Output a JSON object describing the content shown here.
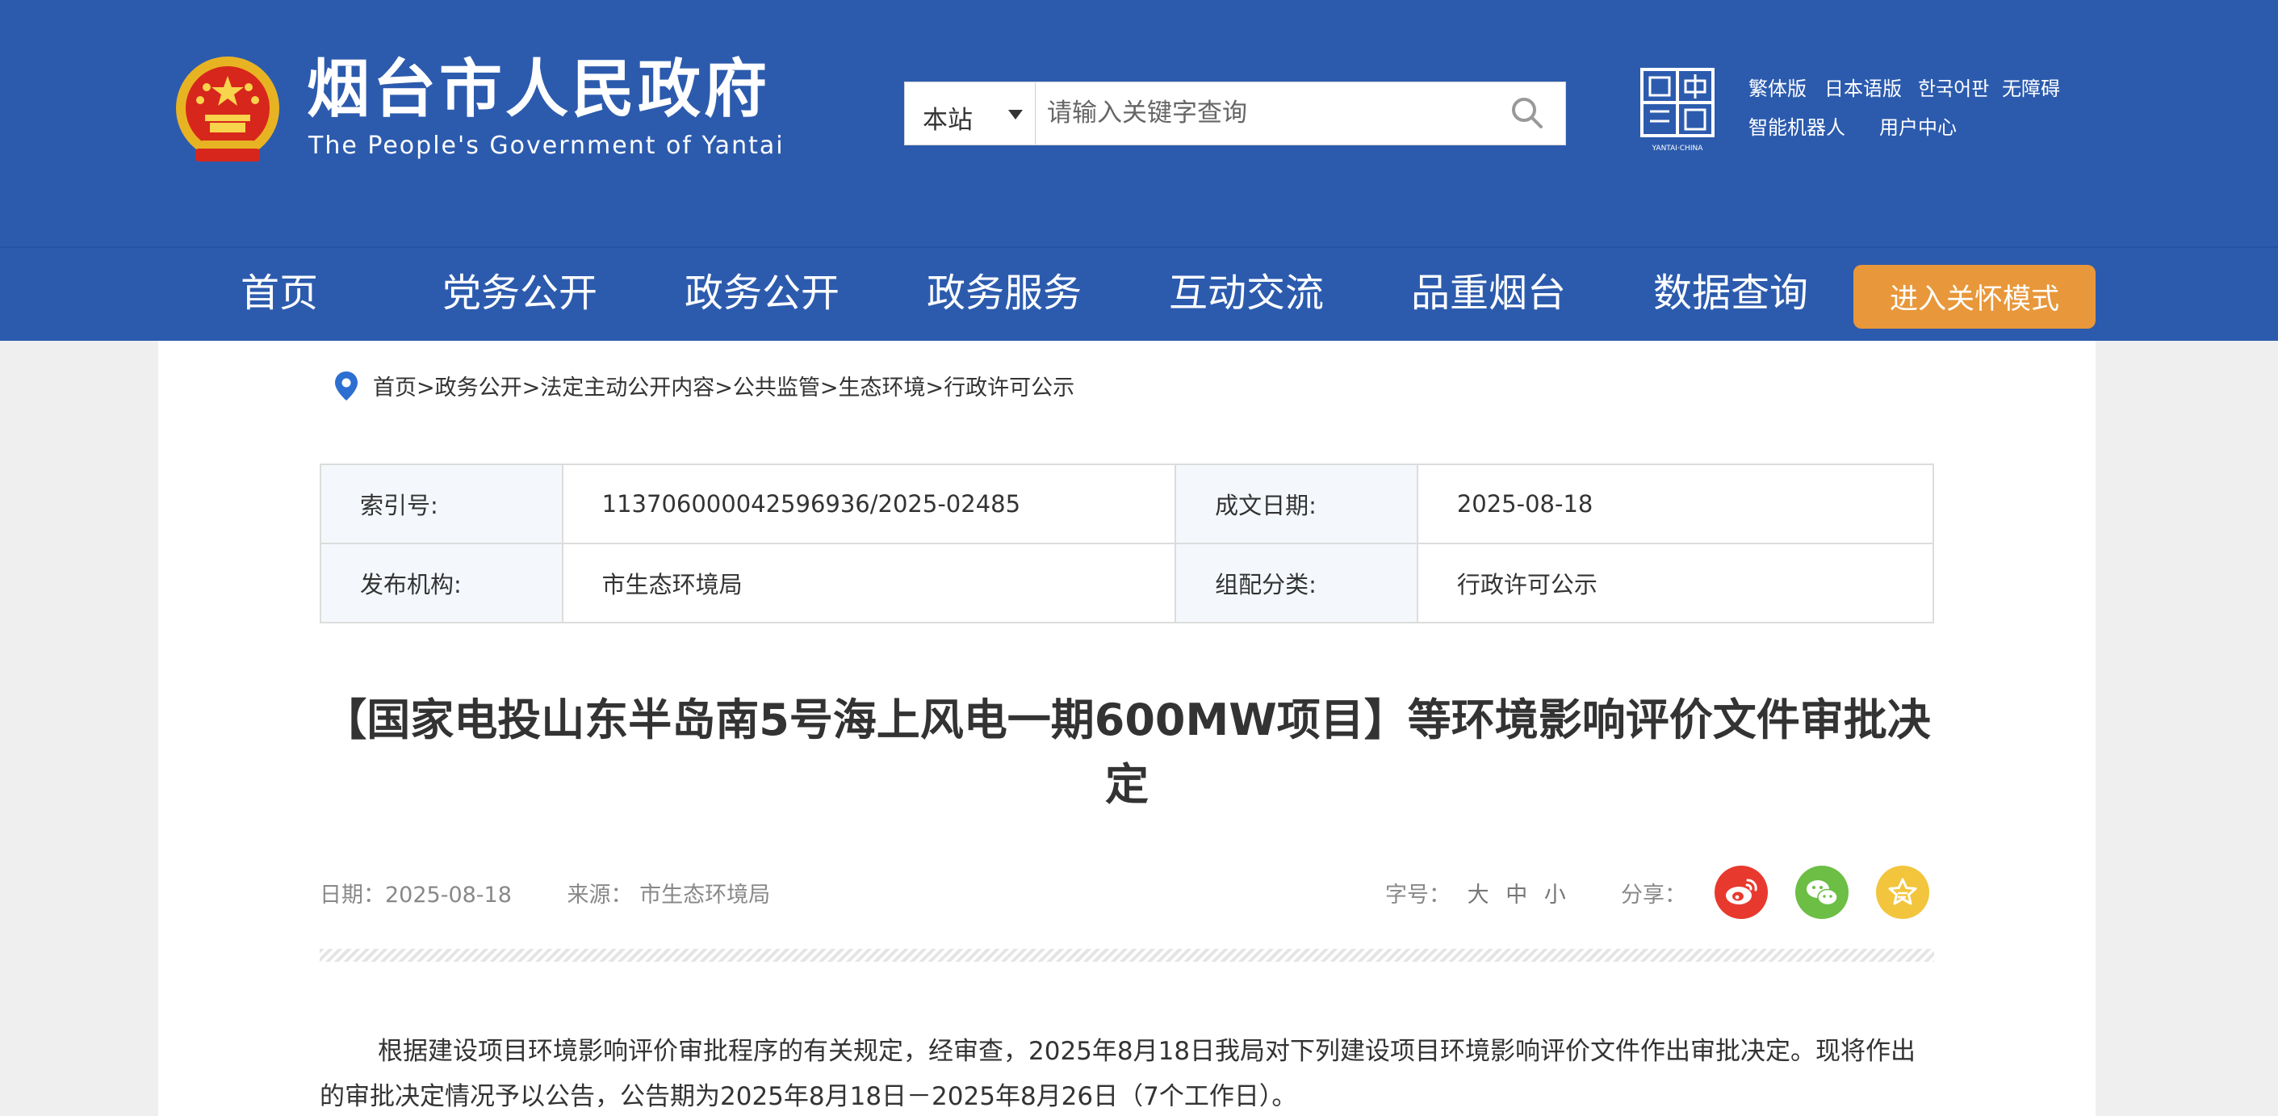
{
  "header": {
    "site_title": "烟台市人民政府",
    "site_subtitle": "The People's Government of Yantai",
    "search": {
      "scope_label": "本站",
      "placeholder": "请输入关键字查询"
    },
    "logo_caption": "YANTAI·CHINA",
    "top_links": [
      "繁体版",
      "日本语版",
      "한국어판",
      "无障碍",
      "智能机器人",
      "用户中心"
    ]
  },
  "nav": {
    "items": [
      "首页",
      "党务公开",
      "政务公开",
      "政务服务",
      "互动交流",
      "品重烟台",
      "数据查询"
    ],
    "care_mode_label": "进入关怀模式"
  },
  "breadcrumb": "首页>政务公开>法定主动公开内容>公共监管>生态环境>行政许可公示",
  "meta": {
    "index_label": "索引号:",
    "index_value": "113706000042596936/2025-02485",
    "date_label": "成文日期:",
    "date_value": "2025-08-18",
    "publisher_label": "发布机构:",
    "publisher_value": "市生态环境局",
    "category_label": "组配分类:",
    "category_value": "行政许可公示"
  },
  "article": {
    "title": "【国家电投山东半岛南5号海上风电一期600MW项目】等环境影响评价文件审批决定",
    "date_text": "日期：2025-08-18",
    "source_text": "来源： 市生态环境局",
    "font_size_label": "字号：",
    "font_sizes": [
      "大",
      "中",
      "小"
    ],
    "share_label": "分享：",
    "share_targets": [
      "weibo-icon",
      "wechat-icon",
      "favorite-icon"
    ],
    "body": "根据建设项目环境影响评价审批程序的有关规定，经审查，2025年8月18日我局对下列建设项目环境影响评价文件作出审批决定。现将作出的审批决定情况予以公告，公告期为2025年8月18日－2025年8月26日（7个工作日）。"
  },
  "colors": {
    "brand_blue": "#2c5bae",
    "care_orange": "#e8973a",
    "weibo_red": "#e8392e",
    "wechat_green": "#6cbe45",
    "favorite_yellow": "#f2c53d"
  }
}
